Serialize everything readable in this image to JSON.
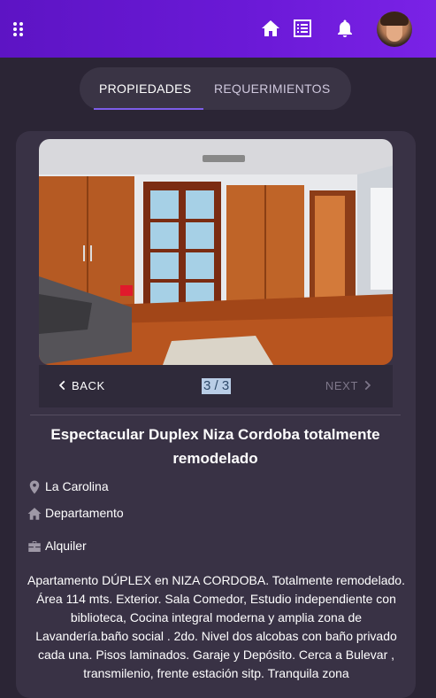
{
  "appbar": {
    "icons": [
      "menu-dots-icon",
      "home-icon",
      "list-icon",
      "bell-icon"
    ],
    "background": "#6a19d6"
  },
  "tabs": [
    {
      "label": "PROPIEDADES",
      "active": true
    },
    {
      "label": "REQUERIMIENTOS",
      "active": false
    }
  ],
  "property": {
    "photo_alt": "Room with wooden doors and parquet floor",
    "back_label": "BACK",
    "next_label": "NEXT",
    "counter": "3 / 3",
    "title": "Espectacular Duplex Niza Cordoba totalmente remodelado",
    "location": "La Carolina",
    "type": "Departamento",
    "operation": "Alquiler",
    "description": "Apartamento DÚPLEX en NIZA CORDOBA. Totalmente remodelado. Área 114 mts. Exterior. Sala Comedor, Estudio independiente con biblioteca, Cocina integral moderna y amplia zona de Lavandería.baño social . 2do. Nivel dos alcobas con baño privado cada una. Pisos laminados. Garaje y Depósito. Cerca a Bulevar , transmilenio, frente estación sitp. Tranquila zona"
  },
  "colors": {
    "accent": "#7d5de8",
    "page_bg": "#2b2535",
    "card_bg": "#393245"
  }
}
